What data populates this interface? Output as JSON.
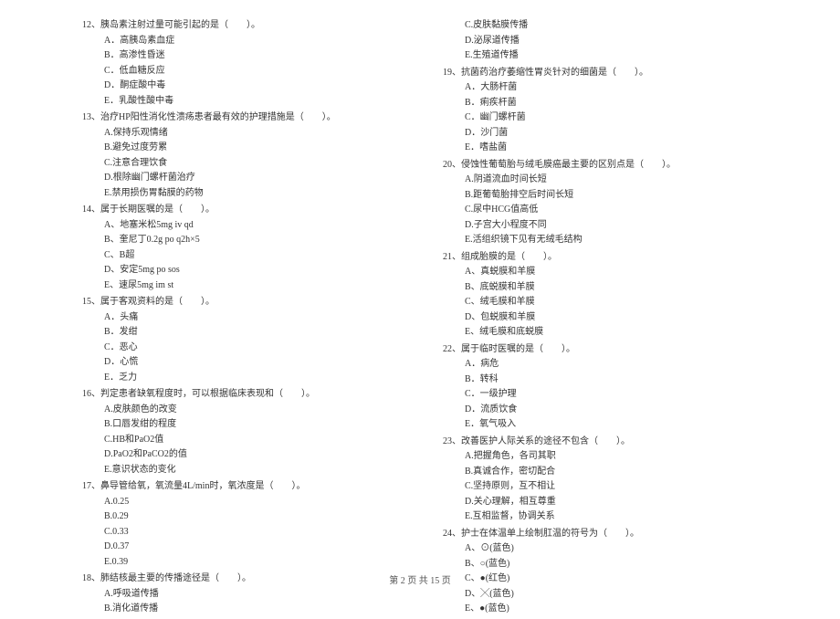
{
  "left_column": {
    "q12": {
      "text": "12、胰岛素注射过量可能引起的是（　　）。",
      "options": [
        "A．高胰岛素血症",
        "B．高渗性昏迷",
        "C．低血糖反应",
        "D．酮症酸中毒",
        "E．乳酸性酸中毒"
      ]
    },
    "q13": {
      "text": "13、治疗HP阳性消化性溃疡患者最有效的护理措施是（　　）。",
      "options": [
        "A.保持乐观情绪",
        "B.避免过度劳累",
        "C.注意合理饮食",
        "D.根除幽门螺杆菌治疗",
        "E.禁用损伤胃黏膜的药物"
      ]
    },
    "q14": {
      "text": "14、属于长期医嘱的是（　　）。",
      "options": [
        "A、地塞米松5mg iv qd",
        "B、奎尼丁0.2g po q2h×5",
        "C、B超",
        "D、安定5mg po sos",
        "E、速尿5mg im st"
      ]
    },
    "q15": {
      "text": "15、属于客观资料的是（　　）。",
      "options": [
        "A．头痛",
        "B．发绀",
        "C．恶心",
        "D．心慌",
        "E．乏力"
      ]
    },
    "q16": {
      "text": "16、判定患者缺氧程度时，可以根据临床表现和（　　）。",
      "options": [
        "A.皮肤颜色的改变",
        "B.口唇发绀的程度",
        "C.HB和PaO2值",
        "D.PaO2和PaCO2的值",
        "E.意识状态的变化"
      ]
    },
    "q17": {
      "text": "17、鼻导管给氧，氧流量4L/min时，氧浓度是（　　）。",
      "options": [
        "A.0.25",
        "B.0.29",
        "C.0.33",
        "D.0.37",
        "E.0.39"
      ]
    },
    "q18": {
      "text": "18、肺结核最主要的传播途径是（　　）。",
      "options": [
        "A.呼吸道传播",
        "B.消化道传播"
      ]
    }
  },
  "right_column": {
    "q18_cont": {
      "options": [
        "C.皮肤黏膜传播",
        "D.泌尿道传播",
        "E.生殖道传播"
      ]
    },
    "q19": {
      "text": "19、抗菌药治疗萎缩性胃炎针对的细菌是（　　）。",
      "options": [
        "A．大肠杆菌",
        "B．痢疾杆菌",
        "C．幽门螺杆菌",
        "D．沙门菌",
        "E．嗜盐菌"
      ]
    },
    "q20": {
      "text": "20、侵蚀性葡萄胎与绒毛膜癌最主要的区别点是（　　）。",
      "options": [
        "A.阴道流血时间长短",
        "B.距葡萄胎排空后时间长短",
        "C.尿中HCG值高低",
        "D.子宫大小程度不同",
        "E.活组织镜下见有无绒毛结构"
      ]
    },
    "q21": {
      "text": "21、组成胎膜的是（　　）。",
      "options": [
        "A、真蜕膜和羊膜",
        "B、底蜕膜和羊膜",
        "C、绒毛膜和羊膜",
        "D、包蜕膜和羊膜",
        "E、绒毛膜和底蜕膜"
      ]
    },
    "q22": {
      "text": "22、属于临时医嘱的是（　　）。",
      "options": [
        "A．病危",
        "B．转科",
        "C．一级护理",
        "D．流质饮食",
        "E．氧气吸入"
      ]
    },
    "q23": {
      "text": "23、改善医护人际关系的途径不包含（　　）。",
      "options": [
        "A.把握角色，各司其职",
        "B.真诚合作，密切配合",
        "C.坚持原则，互不相让",
        "D.关心理解，相互尊重",
        "E.互相监督，协调关系"
      ]
    },
    "q24": {
      "text": "24、护士在体温单上绘制肛温的符号为（　　）。",
      "options": [
        "A、⊙(蓝色)",
        "B、○(蓝色)",
        "C、●(红色)",
        "D、╳(蓝色)",
        "E、●(蓝色)"
      ]
    }
  },
  "footer": "第 2 页 共 15 页"
}
